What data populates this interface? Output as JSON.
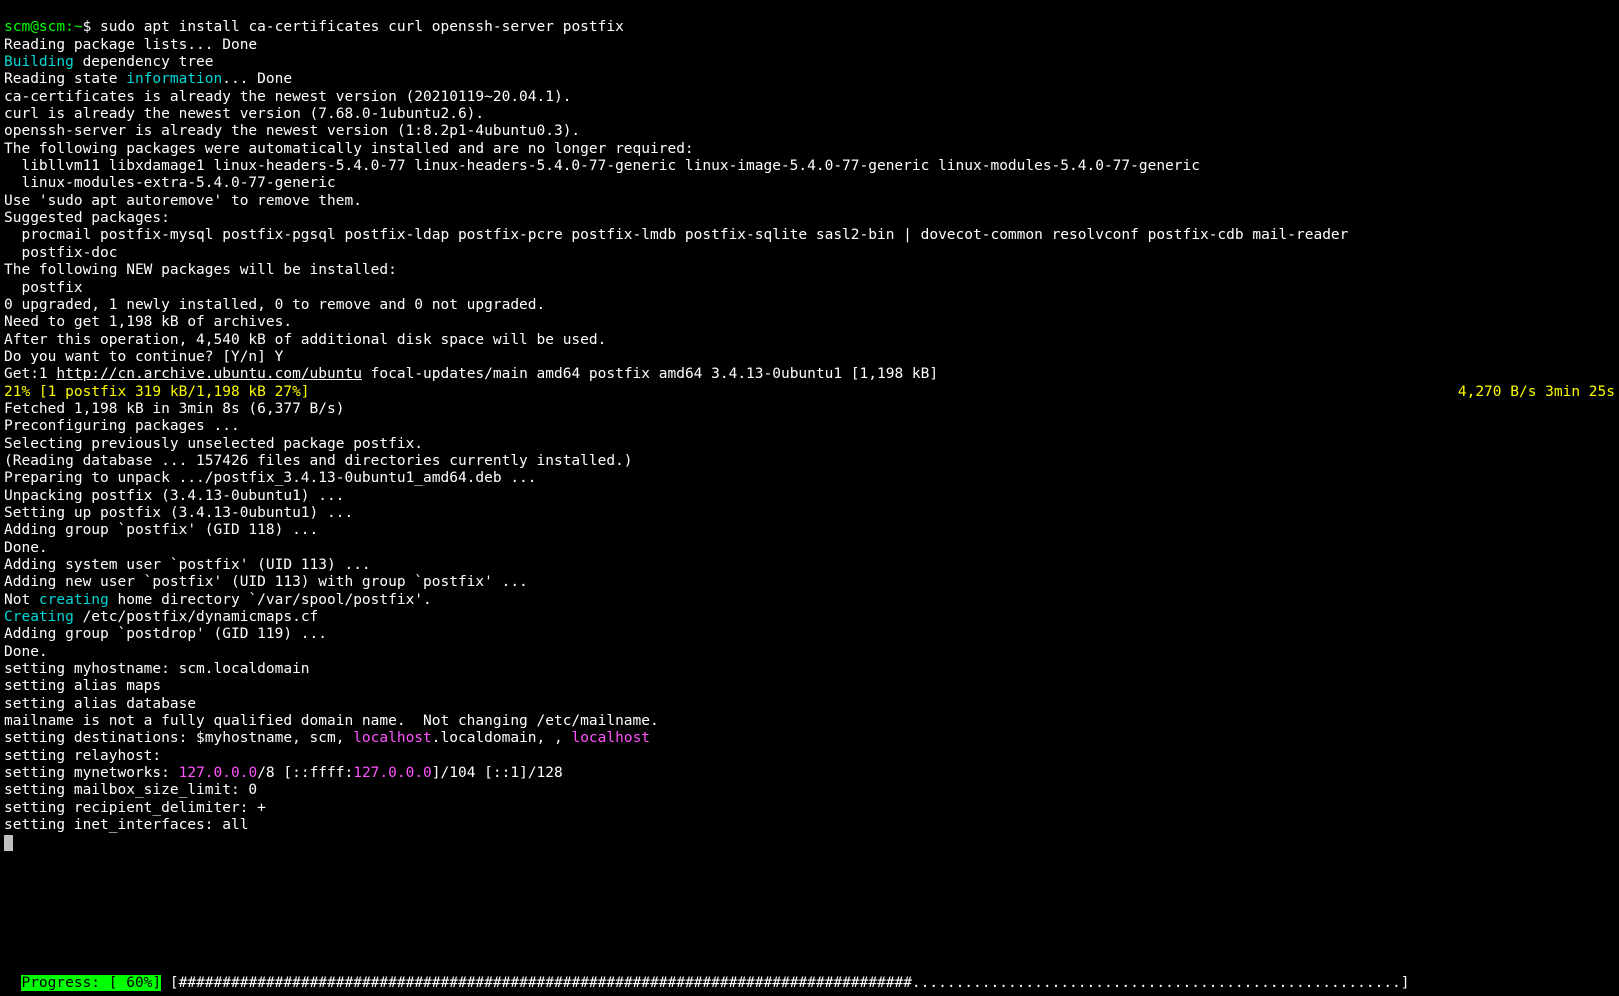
{
  "prompt": {
    "user_host": "scm@scm",
    "cwd": "~",
    "symbol": "$",
    "command": "sudo apt install ca-certificates curl openssh-server postfix"
  },
  "apt": {
    "reading_lists": "Reading package lists... Done",
    "building_word": "Building",
    "dep_tree_rest": " dependency tree",
    "reading_state_prefix": "Reading state ",
    "information_word": "information",
    "reading_state_suffix": "... Done",
    "already_newest": [
      "ca-certificates is already the newest version (20210119~20.04.1).",
      "curl is already the newest version (7.68.0-1ubuntu2.6).",
      "openssh-server is already the newest version (1:8.2p1-4ubuntu0.3)."
    ],
    "auto_installed_header": "The following packages were automatically installed and are no longer required:",
    "auto_installed_line1": "  libllvm11 libxdamage1 linux-headers-5.4.0-77 linux-headers-5.4.0-77-generic linux-image-5.4.0-77-generic linux-modules-5.4.0-77-generic",
    "auto_installed_line2": "  linux-modules-extra-5.4.0-77-generic",
    "autoremove_hint": "Use 'sudo apt autoremove' to remove them.",
    "suggested_header": "Suggested packages:",
    "suggested_line1": "  procmail postfix-mysql postfix-pgsql postfix-ldap postfix-pcre postfix-lmdb postfix-sqlite sasl2-bin | dovecot-common resolvconf postfix-cdb mail-reader",
    "suggested_line2": "  postfix-doc",
    "new_header": "The following NEW packages will be installed:",
    "new_line": "  postfix",
    "summary": "0 upgraded, 1 newly installed, 0 to remove and 0 not upgraded.",
    "need_get": "Need to get 1,198 kB of archives.",
    "after_op": "After this operation, 4,540 kB of additional disk space will be used.",
    "continue_prompt": "Do you want to continue? [Y/n] Y",
    "get_prefix": "Get:1 ",
    "get_url": "http://cn.archive.ubuntu.com/ubuntu",
    "get_suffix": " focal-updates/main amd64 postfix amd64 3.4.13-0ubuntu1 [1,198 kB]",
    "rate_left": "21% [1 postfix 319 kB/1,198 kB 27%]",
    "rate_right": "4,270 B/s 3min 25s",
    "fetched": "Fetched 1,198 kB in 3min 8s (6,377 B/s)",
    "preconfig": "Preconfiguring packages ...",
    "selecting": "Selecting previously unselected package postfix.",
    "reading_db": "(Reading database ... 157426 files and directories currently installed.)",
    "preparing": "Preparing to unpack .../postfix_3.4.13-0ubuntu1_amd64.deb ...",
    "unpacking": "Unpacking postfix (3.4.13-0ubuntu1) ...",
    "setting_up": "Setting up postfix (3.4.13-0ubuntu1) ...",
    "add_group_postfix": "Adding group `postfix' (GID 118) ...",
    "done1": "Done.",
    "add_sysuser": "Adding system user `postfix' (UID 113) ...",
    "add_newuser": "Adding new user `postfix' (UID 113) with group `postfix' ...",
    "not_word": "Not ",
    "creating_word": "creating",
    "homedir_rest": " home directory `/var/spool/postfix'.",
    "creating_word2": "Creating",
    "dynmaps_rest": " /etc/postfix/dynamicmaps.cf",
    "add_group_postdrop": "Adding group `postdrop' (GID 119) ...",
    "done2": "Done.",
    "myhostname": "setting myhostname: scm.localdomain",
    "alias_maps": "setting alias maps",
    "alias_db": "setting alias database",
    "mailname": "mailname is not a fully qualified domain name.  Not changing /etc/mailname.",
    "dest_prefix": "setting destinations: $myhostname, scm, ",
    "dest_localhost1": "localhost",
    "dest_mid": ".localdomain, , ",
    "dest_localhost2": "localhost",
    "relayhost": "setting relayhost:",
    "mynet_prefix": "setting mynetworks: ",
    "mynet_ip1": "127.0.0.0",
    "mynet_mid1": "/8 [::ffff:",
    "mynet_ip2": "127.0.0.0",
    "mynet_mid2": "]/104 [::1]/128",
    "mbox_limit": "setting mailbox_size_limit: 0",
    "recip_delim": "setting recipient_delimiter: +",
    "inet_if": "setting inet_interfaces: all"
  },
  "progress": {
    "label": "Progress: [ 60%]",
    "percent": 60
  }
}
